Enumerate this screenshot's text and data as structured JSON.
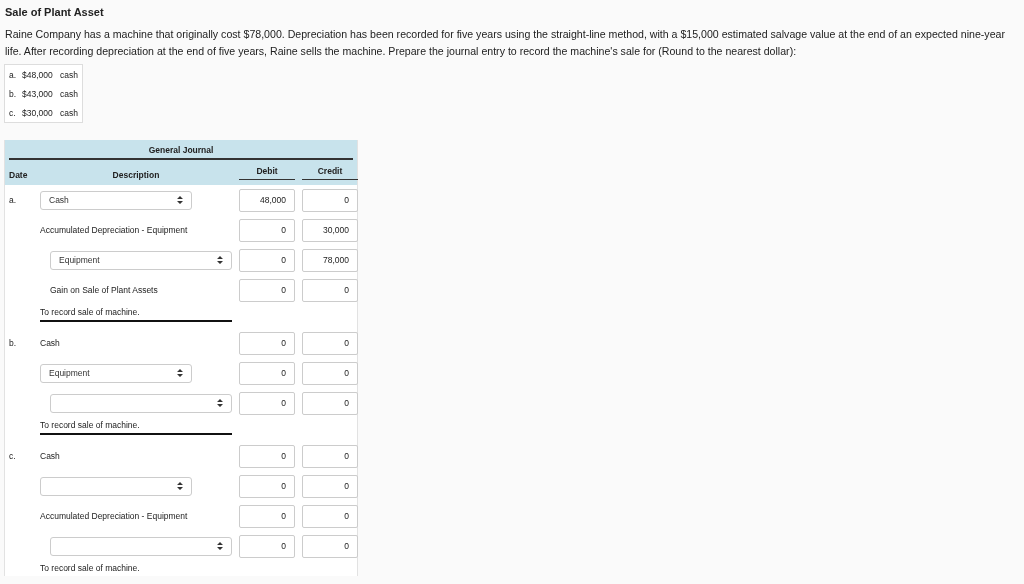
{
  "title": "Sale of Plant Asset",
  "question": "Raine Company has a machine that originally cost $78,000. Depreciation has been recorded for five years using the straight-line method, with a $15,000 estimated salvage value at the end of an expected nine-year life. After recording depreciation at the end of five years, Raine sells the machine. Prepare the journal entry to record the machine's sale for (Round to the nearest dollar):",
  "options": [
    {
      "letter": "a.",
      "amount": "$48,000",
      "label": "cash"
    },
    {
      "letter": "b.",
      "amount": "$43,000",
      "label": "cash"
    },
    {
      "letter": "c.",
      "amount": "$30,000",
      "label": "cash"
    }
  ],
  "journal": {
    "title": "General Journal",
    "columns": [
      "Date",
      "Description",
      "Debit",
      "Credit"
    ],
    "entries": [
      {
        "date": "a.",
        "memo": "To record sale of machine.",
        "lines": [
          {
            "kind": "select",
            "indented": false,
            "account": "Cash",
            "debit": "48,000",
            "credit": "0"
          },
          {
            "kind": "text",
            "indented": false,
            "account": "Accumulated Depreciation - Equipment",
            "debit": "0",
            "credit": "30,000"
          },
          {
            "kind": "select",
            "indented": true,
            "account": "Equipment",
            "debit": "0",
            "credit": "78,000"
          },
          {
            "kind": "text",
            "indented": true,
            "account": "Gain on Sale of Plant Assets",
            "debit": "0",
            "credit": "0"
          }
        ]
      },
      {
        "date": "b.",
        "memo": "To record sale of machine.",
        "lines": [
          {
            "kind": "text",
            "indented": false,
            "account": "Cash",
            "debit": "0",
            "credit": "0"
          },
          {
            "kind": "select",
            "indented": false,
            "account": "Equipment",
            "debit": "0",
            "credit": "0"
          },
          {
            "kind": "select",
            "indented": true,
            "debit": "0",
            "credit": "0"
          }
        ]
      },
      {
        "date": "c.",
        "memo": "To record sale of machine.",
        "lines": [
          {
            "kind": "text",
            "indented": false,
            "account": "Cash",
            "debit": "0",
            "credit": "0"
          },
          {
            "kind": "select",
            "indented": false,
            "debit": "0",
            "credit": "0"
          },
          {
            "kind": "text",
            "indented": false,
            "account": "Accumulated Depreciation - Equipment",
            "debit": "0",
            "credit": "0"
          },
          {
            "kind": "select",
            "indented": true,
            "debit": "0",
            "credit": "0"
          }
        ]
      }
    ]
  }
}
